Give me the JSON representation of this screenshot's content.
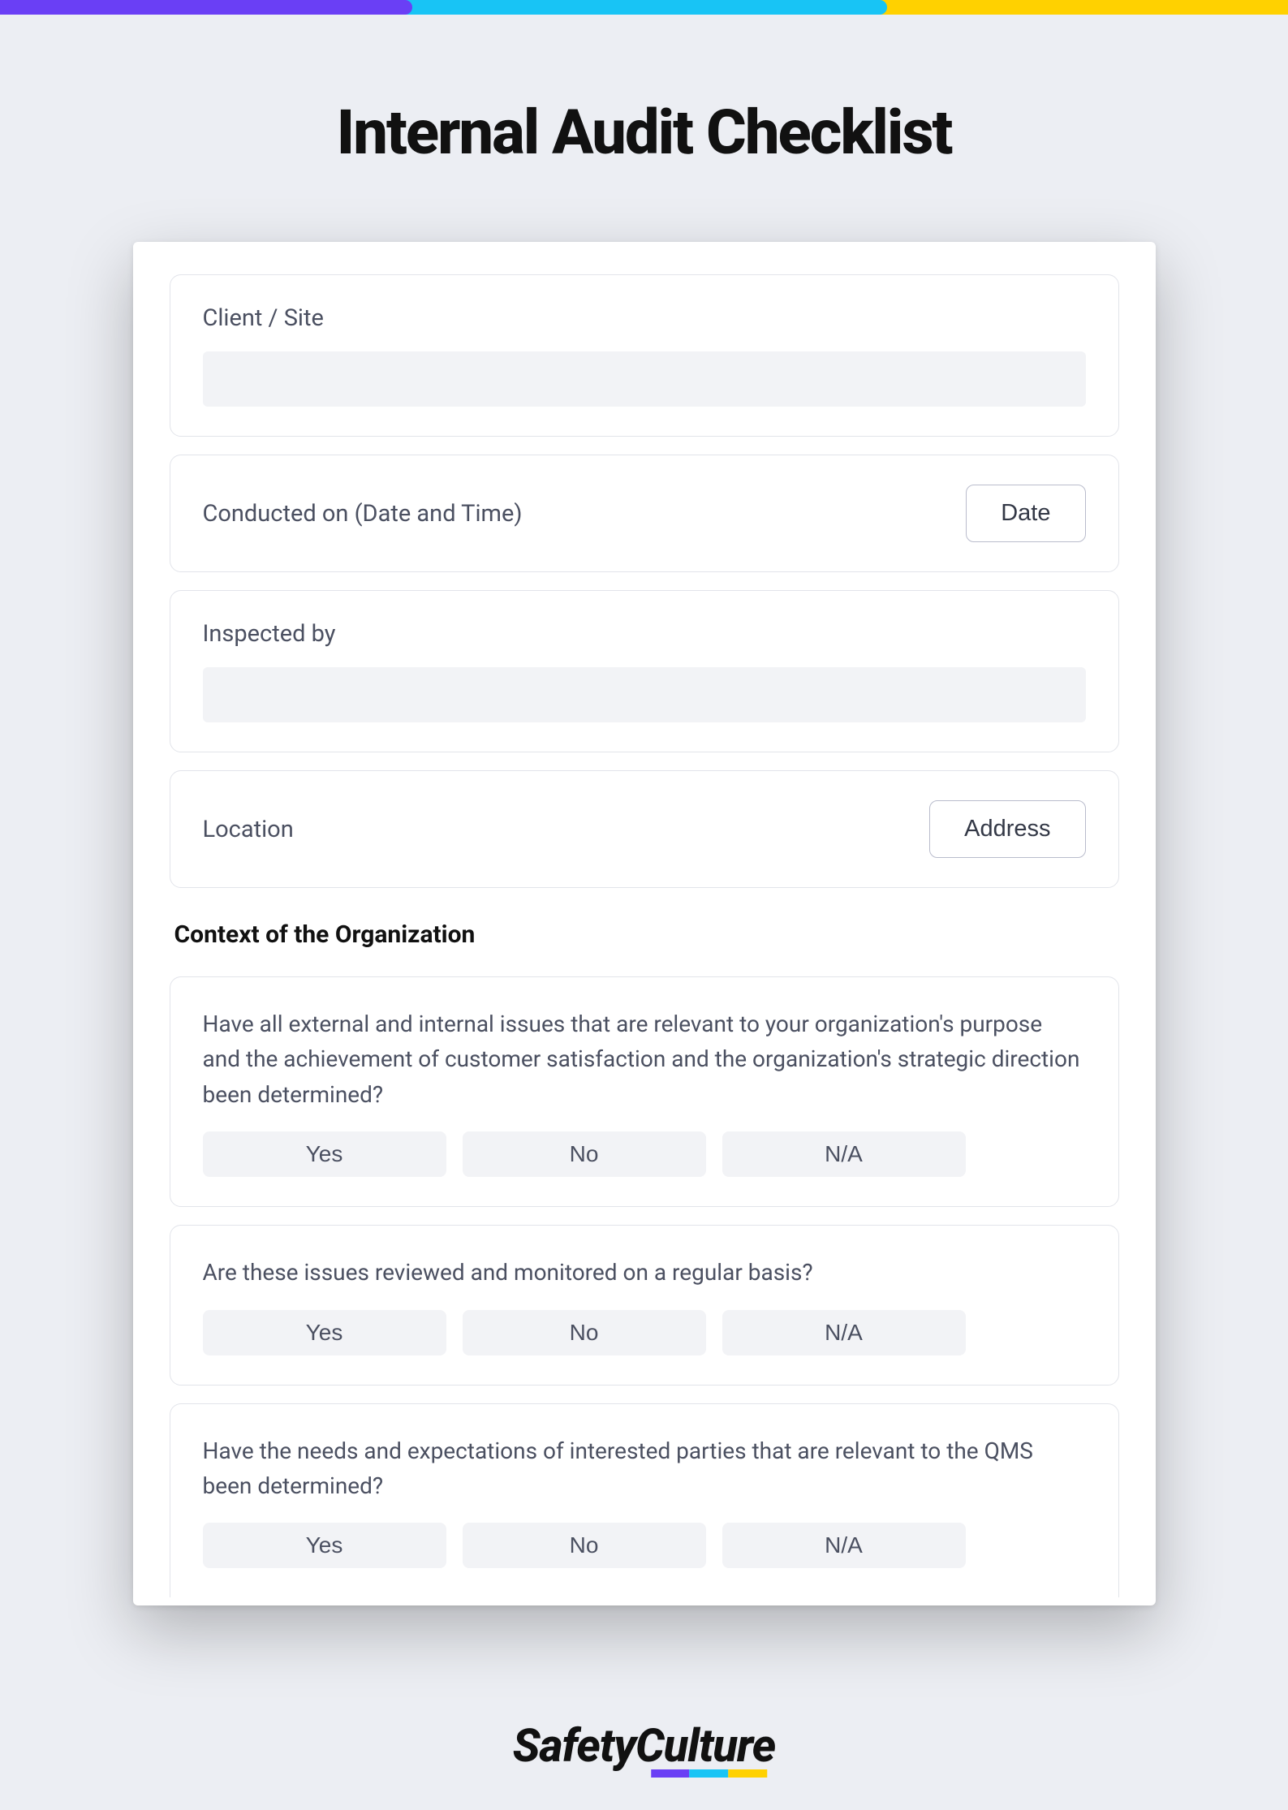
{
  "title": "Internal Audit Checklist",
  "fields": {
    "client_site": {
      "label": "Client / Site"
    },
    "conducted_on": {
      "label": "Conducted on (Date and Time)",
      "button": "Date"
    },
    "inspected_by": {
      "label": "Inspected by"
    },
    "location": {
      "label": "Location",
      "button": "Address"
    }
  },
  "section": {
    "heading": "Context of the Organization",
    "questions": [
      {
        "text": "Have all external and internal issues that are relevant to your organization's purpose and the achievement of customer satisfaction and the organization's strategic direction been determined?",
        "options": [
          "Yes",
          "No",
          "N/A"
        ]
      },
      {
        "text": "Are these issues reviewed and monitored on a regular basis?",
        "options": [
          "Yes",
          "No",
          "N/A"
        ]
      },
      {
        "text": "Have the needs and expectations of interested parties that are relevant to the QMS been determined?",
        "options": [
          "Yes",
          "No",
          "N/A"
        ]
      }
    ]
  },
  "brand": "SafetyCulture"
}
